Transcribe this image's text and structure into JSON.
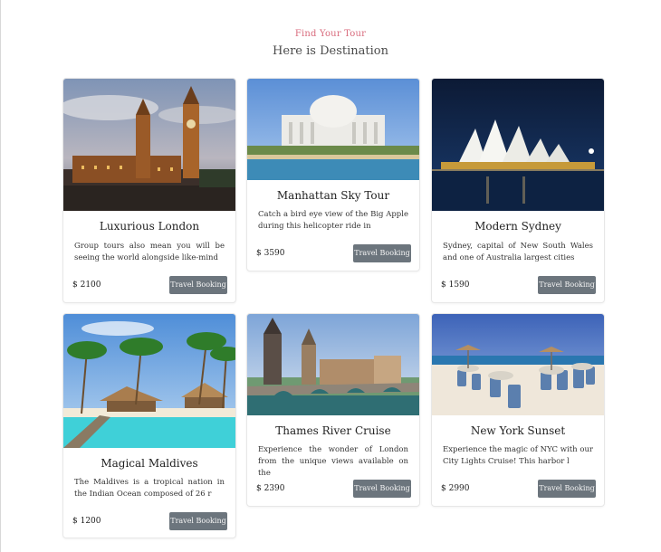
{
  "header": {
    "eyebrow": "Find Your Tour",
    "headline": "Here is Destination"
  },
  "cards": [
    {
      "title": "Luxurious London",
      "description": "Group tours also mean you will be seeing the world alongside like-mind",
      "price": "$ 2100",
      "button": "Travel Booking"
    },
    {
      "title": "Manhattan Sky Tour",
      "description": "Catch a bird eye view of the Big Apple during this helicopter ride in",
      "price": "$ 3590",
      "button": "Travel Booking"
    },
    {
      "title": "Modern Sydney",
      "description": "Sydney, capital of New South Wales and one of Australia largest cities",
      "price": "$ 1590",
      "button": "Travel Booking"
    },
    {
      "title": "Magical Maldives",
      "description": "The Maldives is a tropical nation in the Indian Ocean composed of 26 r",
      "price": "$ 1200",
      "button": "Travel Booking"
    },
    {
      "title": "Thames River Cruise",
      "description": "Experience the wonder of London from the unique views available on the",
      "price": "$ 2390",
      "button": "Travel Booking"
    },
    {
      "title": "New York Sunset",
      "description": "Experience the magic of NYC with our City Lights Cruise! This harbor l",
      "price": "$ 2990",
      "button": "Travel Booking"
    }
  ]
}
